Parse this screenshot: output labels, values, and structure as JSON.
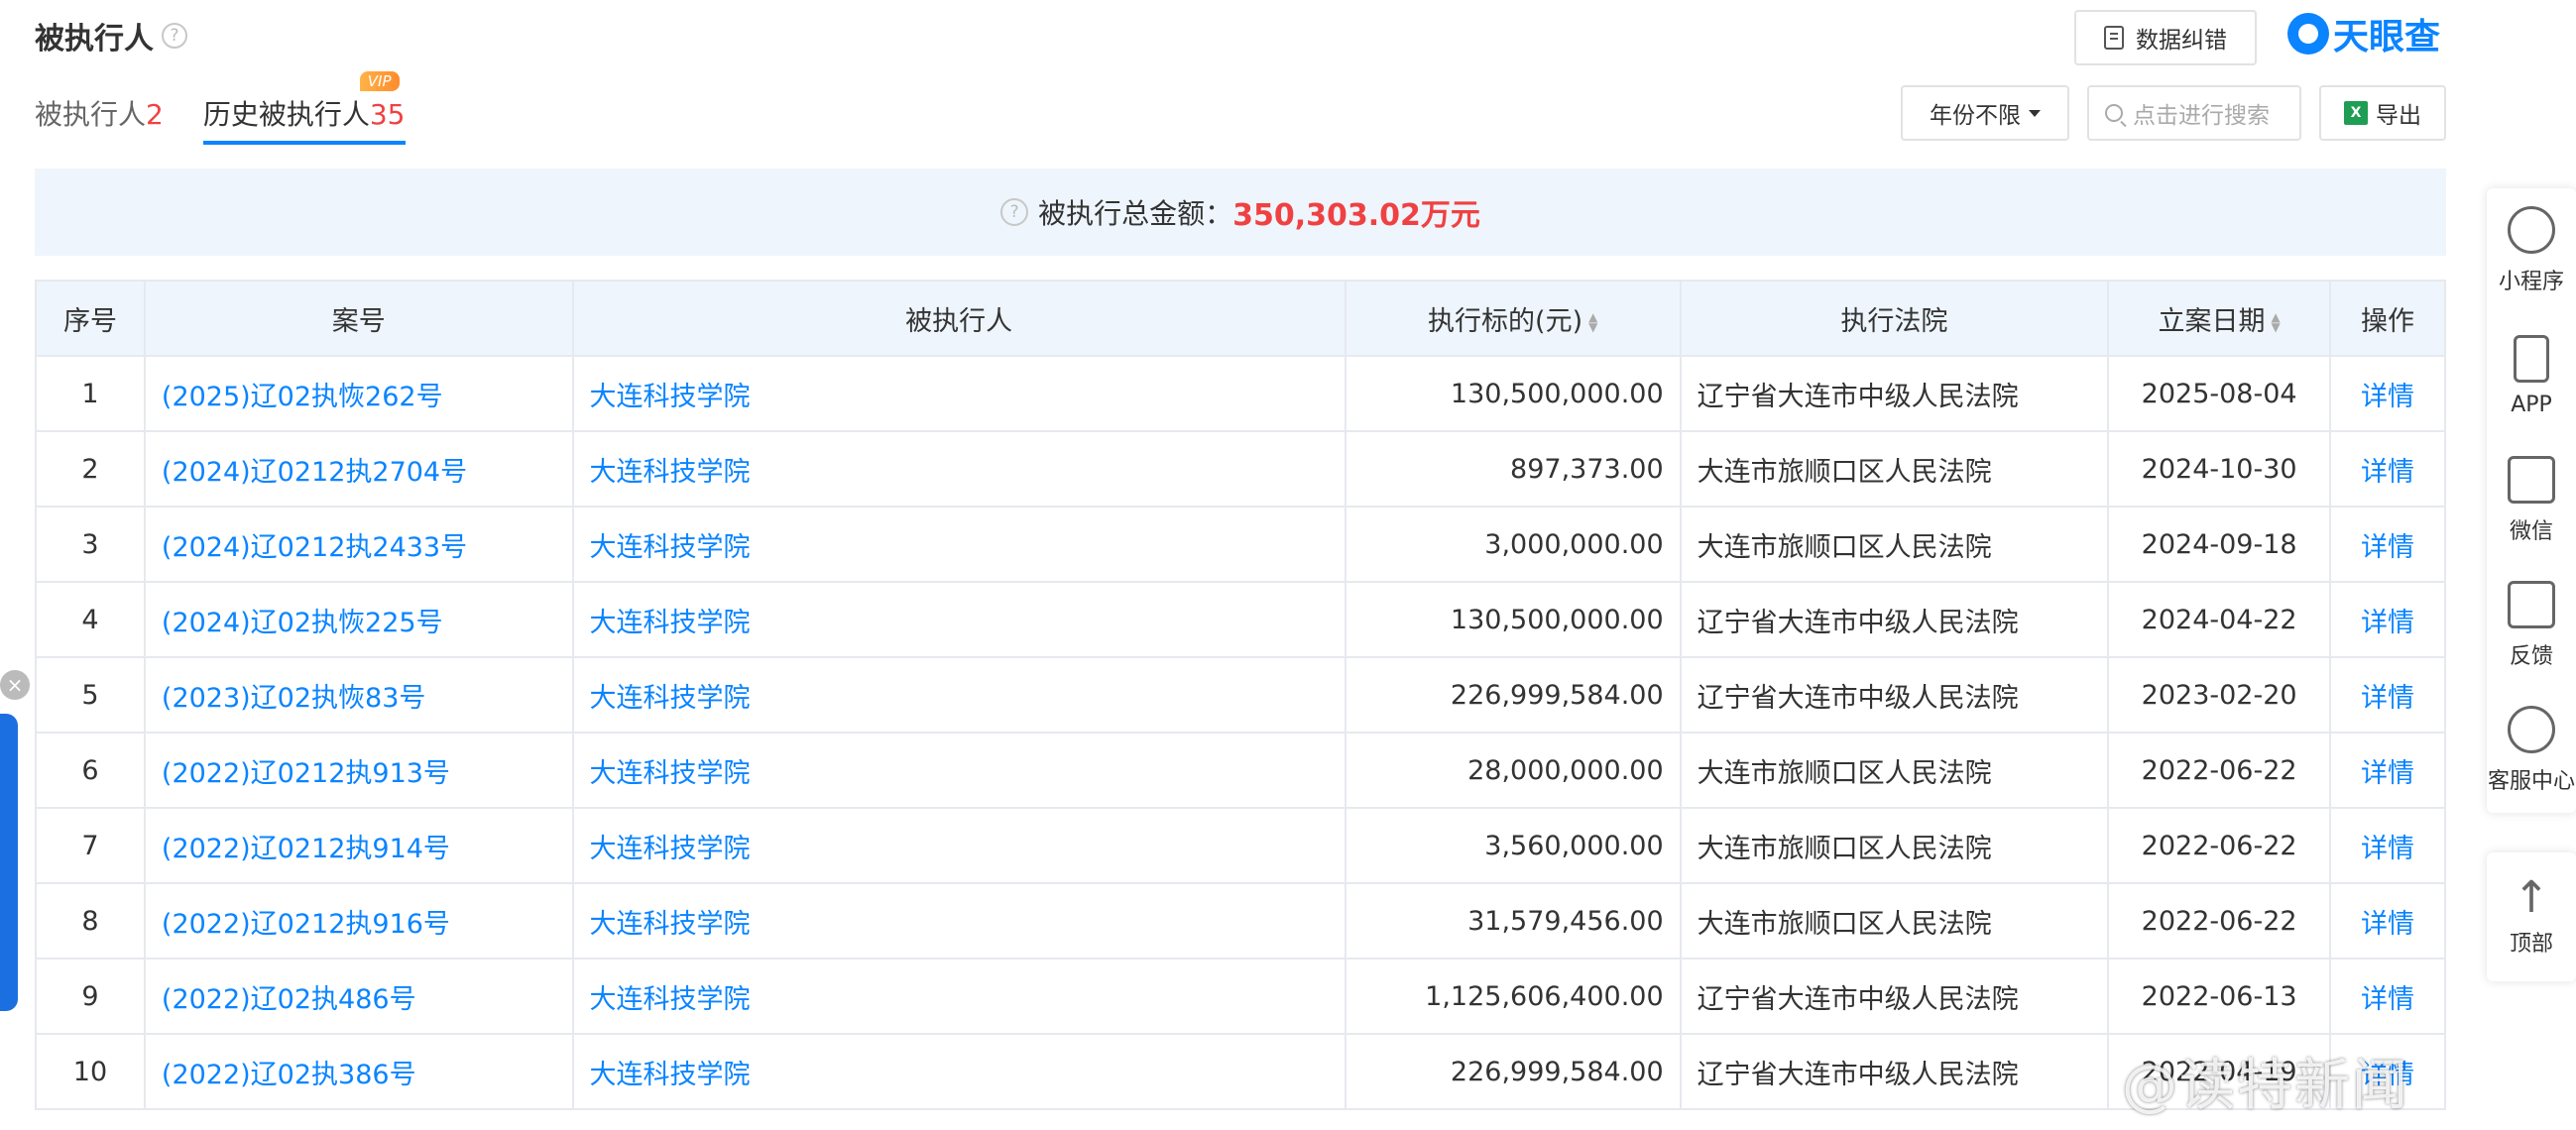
{
  "header": {
    "title": "被执行人",
    "correct_button": "数据纠错",
    "logo_text": "天眼查"
  },
  "tabs": [
    {
      "label": "被执行人",
      "count": "2"
    },
    {
      "label": "历史被执行人",
      "count": "35",
      "badge": "VIP"
    }
  ],
  "controls": {
    "year_filter": "年份不限",
    "search_placeholder": "点击进行搜索",
    "export_label": "导出"
  },
  "summary": {
    "label": "被执行总金额：",
    "amount": "350,303.02万元"
  },
  "table": {
    "headers": [
      "序号",
      "案号",
      "被执行人",
      "执行标的(元)",
      "执行法院",
      "立案日期",
      "操作"
    ],
    "rows": [
      {
        "idx": "1",
        "case": "(2025)辽02执恢262号",
        "party": "大连科技学院",
        "amount": "130,500,000.00",
        "court": "辽宁省大连市中级人民法院",
        "date": "2025-08-04",
        "op": "详情"
      },
      {
        "idx": "2",
        "case": "(2024)辽0212执2704号",
        "party": "大连科技学院",
        "amount": "897,373.00",
        "court": "大连市旅顺口区人民法院",
        "date": "2024-10-30",
        "op": "详情"
      },
      {
        "idx": "3",
        "case": "(2024)辽0212执2433号",
        "party": "大连科技学院",
        "amount": "3,000,000.00",
        "court": "大连市旅顺口区人民法院",
        "date": "2024-09-18",
        "op": "详情"
      },
      {
        "idx": "4",
        "case": "(2024)辽02执恢225号",
        "party": "大连科技学院",
        "amount": "130,500,000.00",
        "court": "辽宁省大连市中级人民法院",
        "date": "2024-04-22",
        "op": "详情"
      },
      {
        "idx": "5",
        "case": "(2023)辽02执恢83号",
        "party": "大连科技学院",
        "amount": "226,999,584.00",
        "court": "辽宁省大连市中级人民法院",
        "date": "2023-02-20",
        "op": "详情"
      },
      {
        "idx": "6",
        "case": "(2022)辽0212执913号",
        "party": "大连科技学院",
        "amount": "28,000,000.00",
        "court": "大连市旅顺口区人民法院",
        "date": "2022-06-22",
        "op": "详情"
      },
      {
        "idx": "7",
        "case": "(2022)辽0212执914号",
        "party": "大连科技学院",
        "amount": "3,560,000.00",
        "court": "大连市旅顺口区人民法院",
        "date": "2022-06-22",
        "op": "详情"
      },
      {
        "idx": "8",
        "case": "(2022)辽0212执916号",
        "party": "大连科技学院",
        "amount": "31,579,456.00",
        "court": "大连市旅顺口区人民法院",
        "date": "2022-06-22",
        "op": "详情"
      },
      {
        "idx": "9",
        "case": "(2022)辽02执486号",
        "party": "大连科技学院",
        "amount": "1,125,606,400.00",
        "court": "辽宁省大连市中级人民法院",
        "date": "2022-06-13",
        "op": "详情"
      },
      {
        "idx": "10",
        "case": "(2022)辽02执386号",
        "party": "大连科技学院",
        "amount": "226,999,584.00",
        "court": "辽宁省大连市中级人民法院",
        "date": "2022-04-19",
        "op": "详情"
      }
    ]
  },
  "sidebar": [
    {
      "label": "小程序",
      "icon": "mini-program-icon"
    },
    {
      "label": "APP",
      "icon": "phone-icon"
    },
    {
      "label": "微信",
      "icon": "qr-code-icon"
    },
    {
      "label": "反馈",
      "icon": "feedback-icon"
    },
    {
      "label": "客服中心",
      "icon": "headset-icon"
    },
    {
      "label": "顶部",
      "icon": "arrow-up-icon"
    }
  ],
  "watermark": "@读特新闻",
  "colors": {
    "accent": "#0a84ff",
    "red": "#f04142",
    "header_bg": "#eef5fc"
  }
}
